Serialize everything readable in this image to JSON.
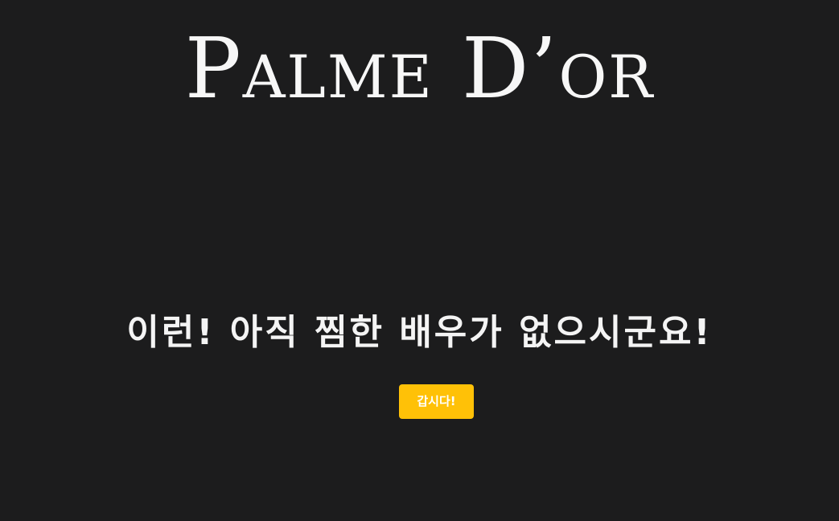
{
  "header": {
    "logo_text": "Palme D’or"
  },
  "main": {
    "empty_message": "이런! 아직 찜한 배우가 없으시군요!",
    "go_button_label": "갑시다!"
  },
  "colors": {
    "background": "#1c1c1d",
    "text": "#f4f4f4",
    "accent": "#ffc107"
  }
}
